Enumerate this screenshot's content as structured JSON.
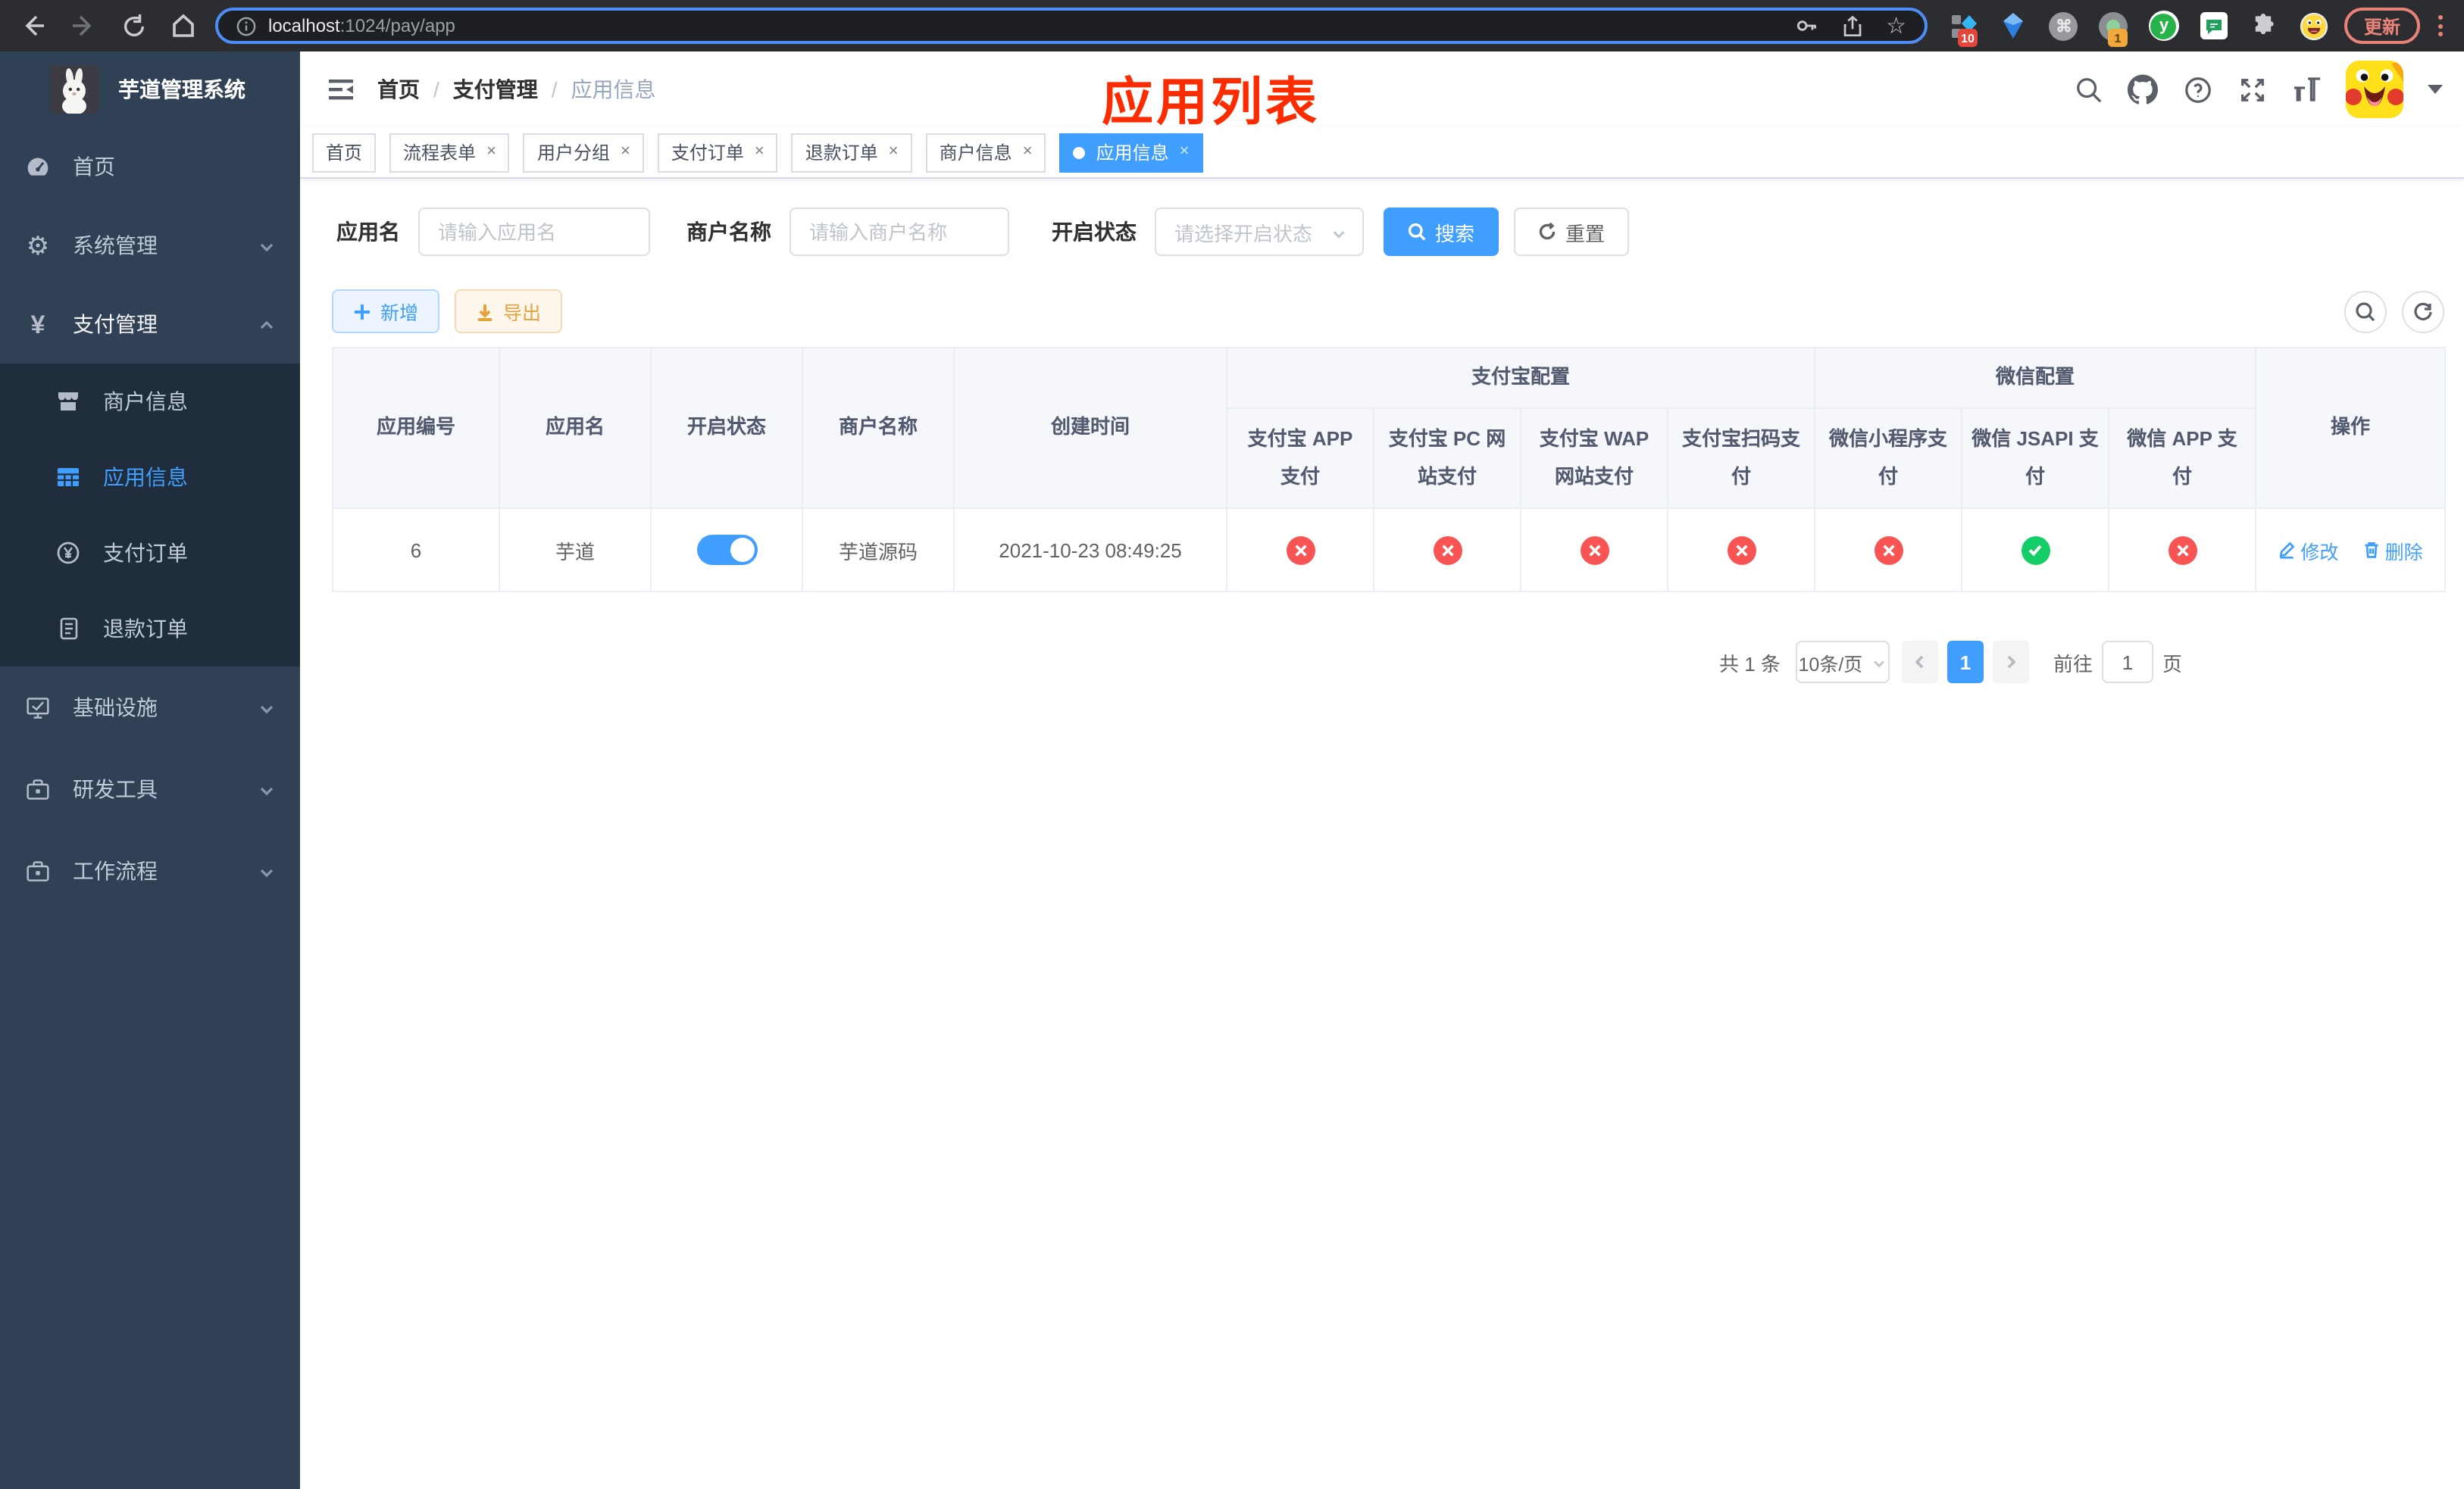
{
  "colors": {
    "primary": "#409eff",
    "success": "#13ce66",
    "danger": "#f85454",
    "warning": "#e6a23c",
    "annotation_red": "#fd2b00",
    "sidebar_bg": "#304156",
    "submenu_bg": "#1f2d3d"
  },
  "browser": {
    "url_host": "localhost",
    "url_path": ":1024/pay/app",
    "update_button": "更新",
    "ext_badge_blue_grid": "10",
    "ext_badge_record": "1",
    "ext_cmd_glyph": "⌘",
    "ext_y_glyph": "y",
    "star_glyph": "☆"
  },
  "sidebar": {
    "app_title": "芋道管理系统",
    "menu": {
      "home": "首页",
      "system": "系统管理",
      "payment": "支付管理",
      "infra": "基础设施",
      "devtools": "研发工具",
      "workflow": "工作流程"
    },
    "submenu": {
      "merchant": "商户信息",
      "app": "应用信息",
      "pay_order": "支付订单",
      "refund_order": "退款订单"
    },
    "yen_glyph": "¥",
    "gear_glyph": "⚙"
  },
  "header": {
    "breadcrumb": {
      "home": "首页",
      "sep": "/",
      "section": "支付管理",
      "current": "应用信息"
    },
    "overlay_title": "应用列表"
  },
  "tabs": {
    "t0": "首页",
    "t1": "流程表单",
    "t2": "用户分组",
    "t3": "支付订单",
    "t4": "退款订单",
    "t5": "商户信息",
    "t6": "应用信息",
    "close_glyph": "×"
  },
  "filters": {
    "app_name_label": "应用名",
    "app_name_placeholder": "请输入应用名",
    "merchant_label": "商户名称",
    "merchant_placeholder": "请输入商户名称",
    "status_label": "开启状态",
    "status_placeholder": "请选择开启状态",
    "search_button": "搜索",
    "reset_button": "重置"
  },
  "toolbar": {
    "add_button": "新增",
    "export_button": "导出"
  },
  "table": {
    "headers": {
      "app_id": "应用编号",
      "app_name": "应用名",
      "status": "开启状态",
      "merchant": "商户名称",
      "create_time": "创建时间",
      "alipay_group": "支付宝配置",
      "wechat_group": "微信配置",
      "alipay_app": "支付宝 APP 支付",
      "alipay_pc": "支付宝 PC 网站支付",
      "alipay_wap": "支付宝 WAP 网站支付",
      "alipay_qr": "支付宝扫码支付",
      "wx_lite": "微信小程序支付",
      "wx_jsapi": "微信 JSAPI 支付",
      "wx_app": "微信 APP 支付",
      "actions": "操作"
    },
    "row": {
      "app_id": "6",
      "app_name": "芋道",
      "merchant": "芋道源码",
      "create_time": "2021-10-23 08:49:25",
      "edit": "修改",
      "delete": "删除"
    }
  },
  "pagination": {
    "total": "共 1 条",
    "page_size": "10条/页",
    "page": "1",
    "goto_label": "前往",
    "goto_value": "1",
    "goto_unit": "页"
  }
}
